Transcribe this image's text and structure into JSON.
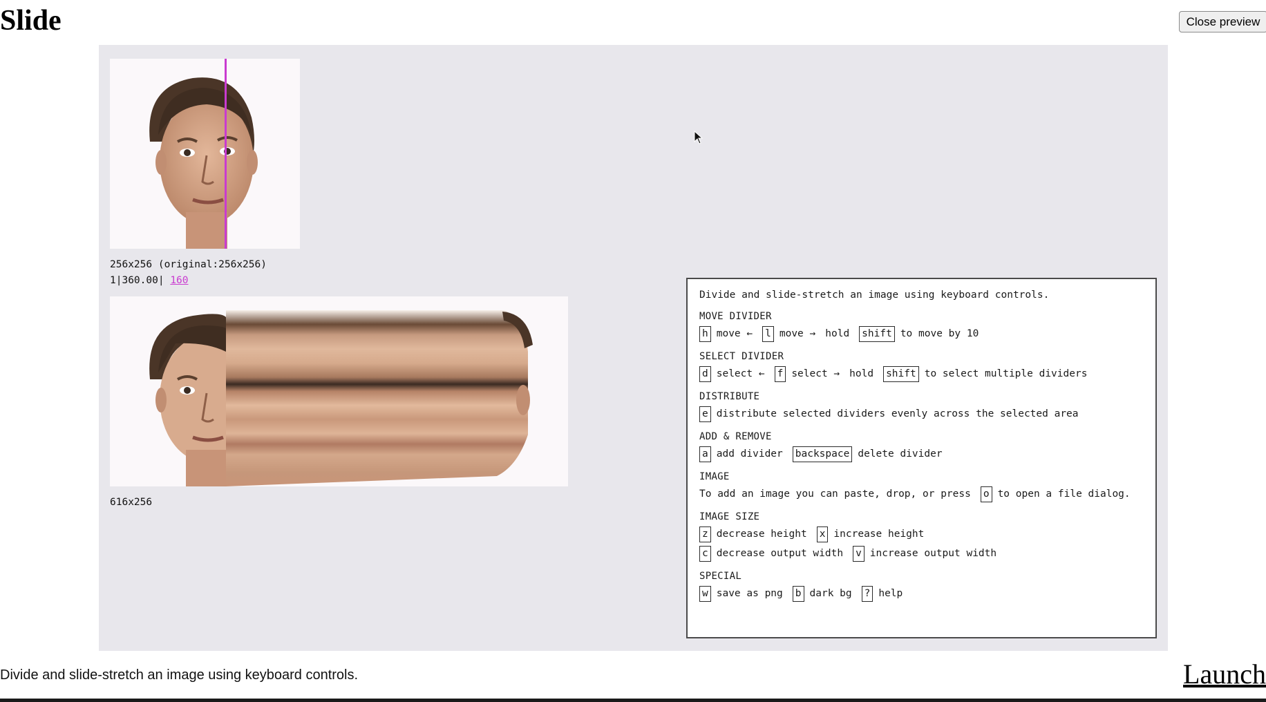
{
  "page": {
    "title": "Slide",
    "close_label": "Close preview"
  },
  "stage": {
    "source_info": "256x256 (original:256x256)",
    "divider_info_prefix": "1|360.00|",
    "divider_info_link": "160",
    "output_info": "616x256"
  },
  "help": {
    "intro": "Divide and slide-stretch an image using keyboard controls.",
    "sections": [
      {
        "heading": "MOVE DIVIDER",
        "rows": [
          [
            {
              "key": "h"
            },
            {
              "text": "move ←"
            },
            {
              "key": "l"
            },
            {
              "text": "move →"
            },
            {
              "text": "hold"
            },
            {
              "key": "shift"
            },
            {
              "text": "to move by 10"
            }
          ]
        ]
      },
      {
        "heading": "SELECT DIVIDER",
        "rows": [
          [
            {
              "key": "d"
            },
            {
              "text": "select ←"
            },
            {
              "key": "f"
            },
            {
              "text": "select →"
            },
            {
              "text": "hold"
            },
            {
              "key": "shift"
            },
            {
              "text": "to select multiple dividers"
            }
          ]
        ]
      },
      {
        "heading": "DISTRIBUTE",
        "rows": [
          [
            {
              "key": "e"
            },
            {
              "text": "distribute selected dividers evenly across the selected area"
            }
          ]
        ]
      },
      {
        "heading": "ADD & REMOVE",
        "rows": [
          [
            {
              "key": "a"
            },
            {
              "text": "add divider"
            },
            {
              "key": "backspace"
            },
            {
              "text": "delete divider"
            }
          ]
        ]
      },
      {
        "heading": "IMAGE",
        "rows": [
          [
            {
              "text": "To add an image you can paste, drop, or press"
            },
            {
              "key": "o"
            },
            {
              "text": "to open a file dialog."
            }
          ]
        ]
      },
      {
        "heading": "IMAGE SIZE",
        "rows": [
          [
            {
              "key": "z"
            },
            {
              "text": "decrease height"
            },
            {
              "key": "x"
            },
            {
              "text": "increase height"
            }
          ],
          [
            {
              "key": "c"
            },
            {
              "text": "decrease output width"
            },
            {
              "key": "v"
            },
            {
              "text": "increase output width"
            }
          ]
        ]
      },
      {
        "heading": "SPECIAL",
        "rows": [
          [
            {
              "key": "w"
            },
            {
              "text": "save as png"
            },
            {
              "key": "b"
            },
            {
              "text": "dark bg"
            },
            {
              "key": "?"
            },
            {
              "text": "help"
            }
          ]
        ]
      }
    ]
  },
  "footer": {
    "description": "Divide and slide-stretch an image using keyboard controls.",
    "launch_label": "Launch"
  },
  "colors": {
    "accent": "#c93bd0",
    "stage_bg": "#e8e7ec"
  },
  "icons": {
    "cursor": "mouse-pointer-icon"
  }
}
